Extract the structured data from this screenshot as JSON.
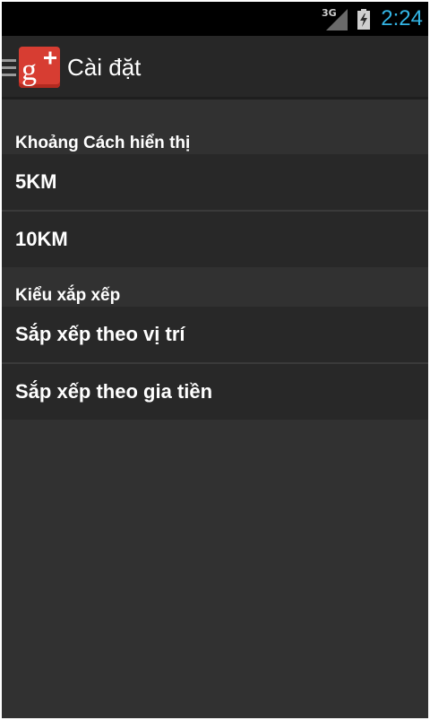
{
  "status_bar": {
    "network": "3G",
    "time": "2:24"
  },
  "action_bar": {
    "title": "Cài đặt",
    "app_icon": "google-plus-icon",
    "menu_icon": "hamburger-menu-icon"
  },
  "sections": [
    {
      "header": "Khoảng Cách hiển thị",
      "items": [
        "5KM",
        "10KM"
      ]
    },
    {
      "header": "Kiểu xắp xếp",
      "items": [
        "Sắp xếp theo vị trí",
        "Sắp xếp theo gia tiền"
      ]
    }
  ],
  "colors": {
    "clock": "#33b5e5",
    "background": "#313131",
    "item_background": "#282828",
    "brand": "#d73d32"
  }
}
